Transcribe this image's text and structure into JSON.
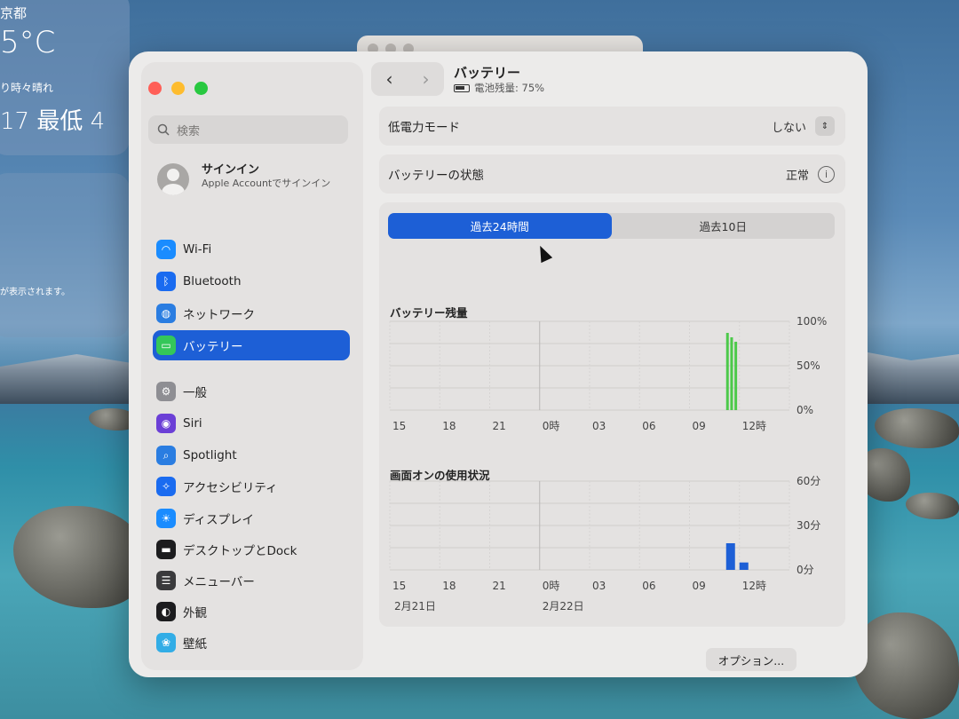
{
  "desktop": {
    "weather": {
      "city": "京都",
      "temp": "5°C",
      "condition": "り時々晴れ",
      "range": "17 最低 4"
    },
    "widget2_message": "が表示されます。"
  },
  "sidebar": {
    "search_placeholder": "検索",
    "account": {
      "title": "サインイン",
      "subtitle": "Apple Accountでサインイン"
    },
    "items": [
      {
        "label": "Wi-Fi",
        "icon": "wifi-icon",
        "color": "#1a8cff"
      },
      {
        "label": "Bluetooth",
        "icon": "bluetooth-icon",
        "color": "#1a6bf0"
      },
      {
        "label": "ネットワーク",
        "icon": "globe-icon",
        "color": "#2a7de1"
      },
      {
        "label": "バッテリー",
        "icon": "battery-icon",
        "color": "#34c759",
        "active": true
      },
      {
        "label": "一般",
        "icon": "gear-icon",
        "color": "#8e8e93"
      },
      {
        "label": "Siri",
        "icon": "siri-icon",
        "color": "#6b3fd6"
      },
      {
        "label": "Spotlight",
        "icon": "magnifier-icon",
        "color": "#2a7de1"
      },
      {
        "label": "アクセシビリティ",
        "icon": "accessibility-icon",
        "color": "#1a6bf0"
      },
      {
        "label": "ディスプレイ",
        "icon": "sun-icon",
        "color": "#1a8cff"
      },
      {
        "label": "デスクトップとDock",
        "icon": "dock-icon",
        "color": "#1c1c1e"
      },
      {
        "label": "メニューバー",
        "icon": "menubar-icon",
        "color": "#3a3a3c"
      },
      {
        "label": "外観",
        "icon": "appearance-icon",
        "color": "#1c1c1e"
      },
      {
        "label": "壁紙",
        "icon": "wallpaper-icon",
        "color": "#32ade6"
      }
    ]
  },
  "main": {
    "title": "バッテリー",
    "subtitle": "電池残量: 75%",
    "low_power": {
      "label": "低電力モード",
      "value": "しない"
    },
    "battery_health": {
      "label": "バッテリーの状態",
      "value": "正常"
    },
    "tabs": [
      {
        "label": "過去24時間",
        "active": true
      },
      {
        "label": "過去10日",
        "active": false
      }
    ],
    "options_button": "オプション...",
    "help_button": "?"
  },
  "chart_data": [
    {
      "type": "bar",
      "title": "バッテリー残量",
      "x_ticks": [
        "15",
        "18",
        "21",
        "0時",
        "03",
        "06",
        "09",
        "12時"
      ],
      "y_ticks": [
        "100%",
        "50%",
        "0%"
      ],
      "ylim": [
        0,
        100
      ],
      "color": "#4cc94a",
      "values": [
        {
          "pos": 11.2,
          "value": 87
        },
        {
          "pos": 11.45,
          "value": 82
        },
        {
          "pos": 11.7,
          "value": 77
        }
      ]
    },
    {
      "type": "bar",
      "title": "画面オンの使用状況",
      "x_ticks": [
        "15",
        "18",
        "21",
        "0時",
        "03",
        "06",
        "09",
        "12時"
      ],
      "date_labels": [
        "2月21日",
        "2月22日"
      ],
      "y_ticks": [
        "60分",
        "30分",
        "0分"
      ],
      "ylim": [
        0,
        60
      ],
      "color": "#1d5fd6",
      "values": [
        {
          "pos": 11.2,
          "value": 18
        },
        {
          "pos": 12.0,
          "value": 5
        }
      ]
    }
  ]
}
